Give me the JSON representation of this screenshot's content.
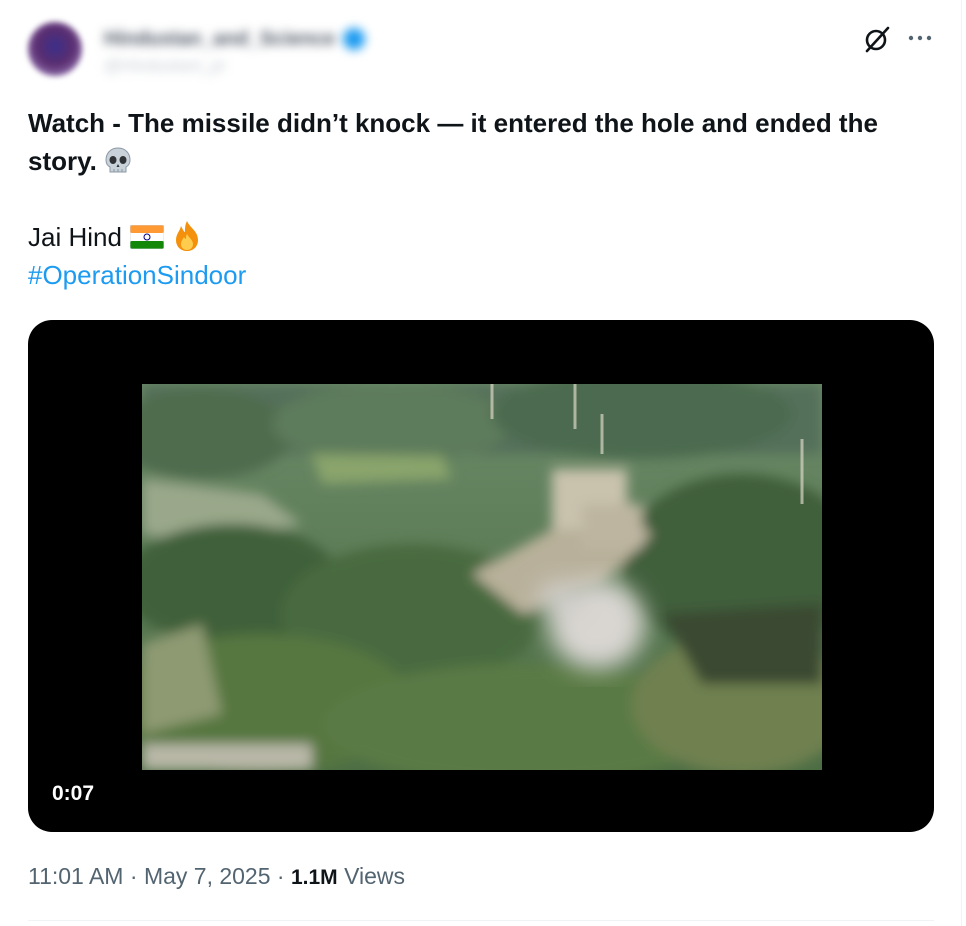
{
  "author": {
    "display_name": "Hindustan_and_Science",
    "handle": "@Hindustani_pr"
  },
  "header": {
    "grok_icon": "grok-slash-icon",
    "more_icon": "more-horizontal-icon"
  },
  "tweet": {
    "line1": "Watch - The missile didn’t knock — it entered the hole and ended the story.",
    "line1_emoji": "skull-emoji",
    "line2": "Jai Hind",
    "line2_emojis": [
      "india-flag-emoji",
      "fire-emoji"
    ],
    "hashtag": "#OperationSindoor"
  },
  "media": {
    "type": "video",
    "duration": "0:07"
  },
  "meta": {
    "time": "11:01 AM",
    "separator": "·",
    "date": "May 7, 2025",
    "views_count": "1.1M",
    "views_label": "Views"
  },
  "colors": {
    "accent": "#1d9bf0",
    "text_primary": "#0f1419",
    "text_secondary": "#536471",
    "media_bg": "#000000"
  }
}
